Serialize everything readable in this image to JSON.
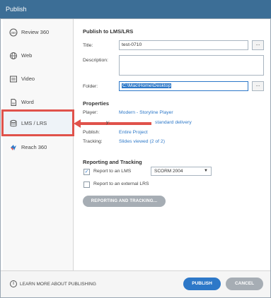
{
  "window": {
    "title": "Publish"
  },
  "sidebar": {
    "items": [
      {
        "label": "Review 360",
        "icon": "review-360-icon"
      },
      {
        "label": "Web",
        "icon": "globe-icon"
      },
      {
        "label": "Video",
        "icon": "video-icon"
      },
      {
        "label": "Word",
        "icon": "word-doc-icon"
      },
      {
        "label": "LMS / LRS",
        "icon": "database-icon",
        "active": true
      },
      {
        "label": "Reach 360",
        "icon": "reach-360-icon"
      }
    ]
  },
  "main": {
    "heading": "Publish to LMS/LRS",
    "fields": {
      "title_label": "Title:",
      "title_value": "test-0710",
      "description_label": "Description:",
      "description_value": "",
      "folder_label": "Folder:",
      "folder_value": "C:\\Mac\\Home\\Desktop",
      "browse_label": "..."
    },
    "properties": {
      "heading": "Properties",
      "player_label": "Player:",
      "player_value": "Modern - Storyline Player",
      "quality_label": "y:",
      "quality_value": "standard delivery",
      "publish_label": "Publish:",
      "publish_value": "Entire Project",
      "tracking_label": "Tracking:",
      "tracking_value": "Slides viewed (2 of 2)"
    },
    "reporting": {
      "heading": "Reporting and Tracking",
      "report_lms_label": "Report to an LMS",
      "report_lms_checked": true,
      "lms_standard": "SCORM 2004",
      "report_lrs_label": "Report to an external LRS",
      "report_lrs_checked": false,
      "button_label": "REPORTING AND TRACKING..."
    }
  },
  "footer": {
    "learn_more": "LEARN MORE ABOUT PUBLISHING",
    "publish_label": "PUBLISH",
    "cancel_label": "CANCEL"
  },
  "colors": {
    "accent": "#2d78c8",
    "highlight": "#e0524b",
    "titlebar": "#3c6e96"
  }
}
